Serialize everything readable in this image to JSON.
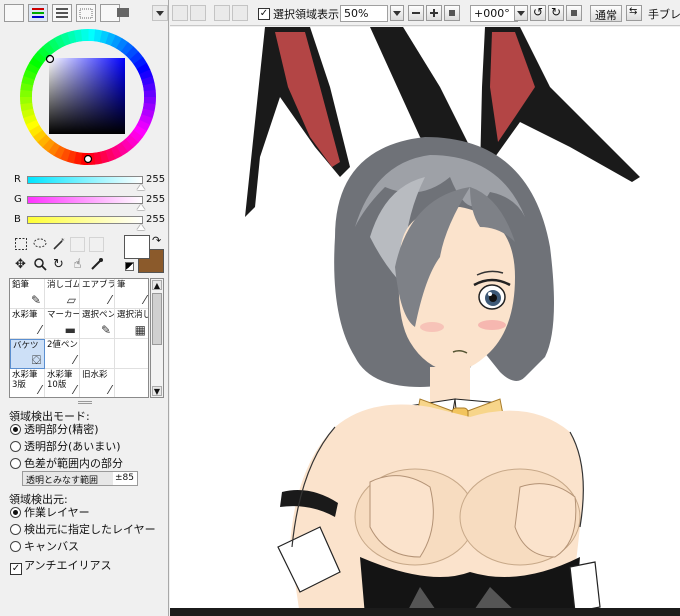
{
  "toolbar": {
    "selection_display_label": "選択領域表示",
    "selection_display_checked": true,
    "zoom_value": "50%",
    "rotation_value": "+000°",
    "blend_mode": "通常",
    "stabilizer_label": "手ブレ補"
  },
  "color_panel": {
    "sliders": [
      {
        "label": "R",
        "value": "255",
        "color": "#00e5ff"
      },
      {
        "label": "G",
        "value": "255",
        "color": "#ff33ff"
      },
      {
        "label": "B",
        "value": "255",
        "color": "#ffff33"
      }
    ],
    "primary_color": "#ffffff",
    "secondary_color": "#8b5a2b",
    "hue_selected": "#0000ff"
  },
  "brush_tools": [
    {
      "label": "鉛筆",
      "icon": "pencil-icon"
    },
    {
      "label": "消しゴム",
      "icon": "eraser-icon"
    },
    {
      "label": "エアブラシ",
      "icon": "airbrush-icon"
    },
    {
      "label": "筆",
      "icon": "brush-icon"
    },
    {
      "label": "水彩筆",
      "icon": "watercolor-icon"
    },
    {
      "label": "マーカー",
      "icon": "marker-icon"
    },
    {
      "label": "選択ペン",
      "icon": "selection-pen-icon"
    },
    {
      "label": "選択消し",
      "icon": "selection-eraser-icon"
    },
    {
      "label": "バケツ",
      "icon": "bucket-icon"
    },
    {
      "label": "2値ペン",
      "icon": "binary-pen-icon"
    },
    {
      "label": "",
      "icon": ""
    },
    {
      "label": "",
      "icon": ""
    },
    {
      "label": "水彩筆\n3版",
      "icon": "watercolor3-icon"
    },
    {
      "label": "水彩筆\n10版",
      "icon": "watercolor10-icon"
    },
    {
      "label": "旧水彩",
      "icon": "old-watercolor-icon"
    },
    {
      "label": "",
      "icon": ""
    }
  ],
  "fill_settings": {
    "detect_mode_label": "領域検出モード:",
    "detect_modes": [
      {
        "label": "透明部分(精密)",
        "selected": true
      },
      {
        "label": "透明部分(あいまい)",
        "selected": false
      },
      {
        "label": "色差が範囲内の部分",
        "selected": false
      }
    ],
    "tolerance_label": "透明とみなす範囲",
    "tolerance_value": "±85",
    "detect_source_label": "領域検出元:",
    "detect_sources": [
      {
        "label": "作業レイヤー",
        "selected": true
      },
      {
        "label": "検出元に指定したレイヤー",
        "selected": false
      },
      {
        "label": "キャンバス",
        "selected": false
      }
    ],
    "antialias_label": "アンチエイリアス",
    "antialias_checked": true
  }
}
